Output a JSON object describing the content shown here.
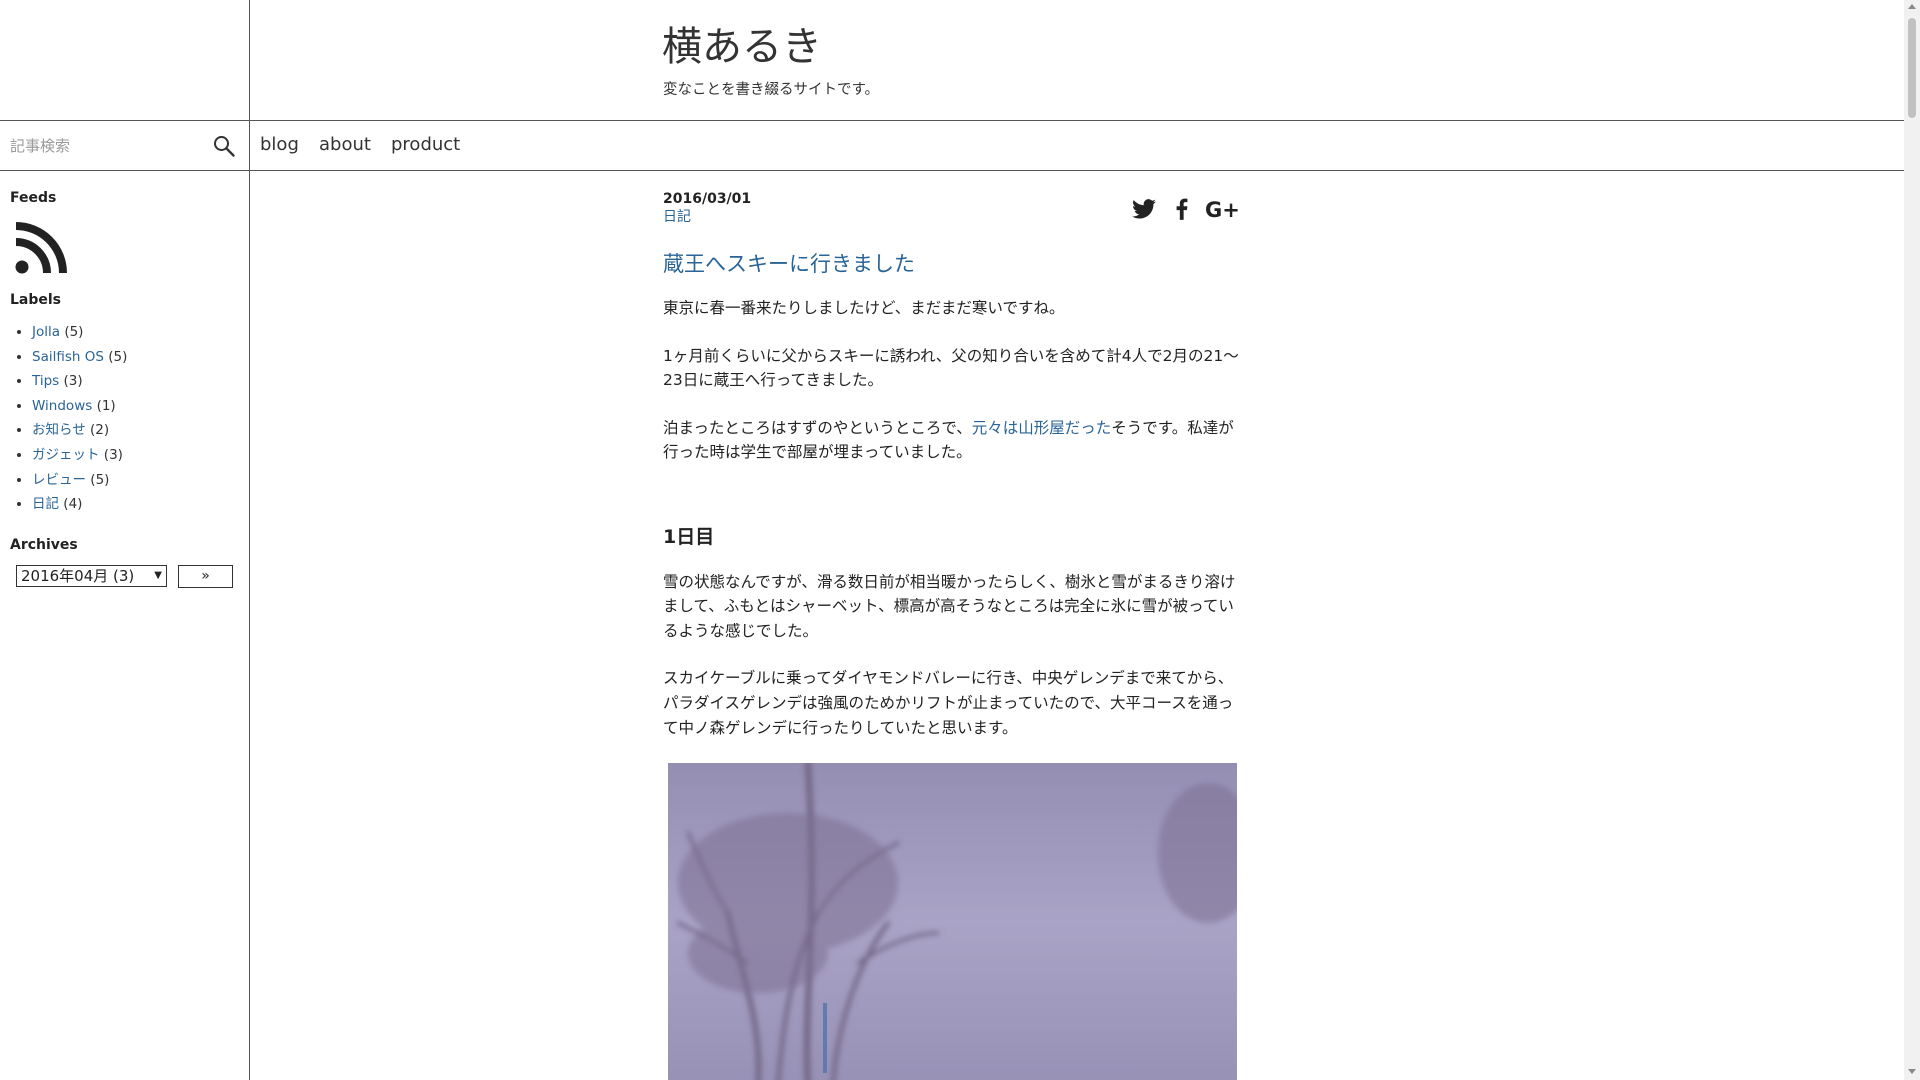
{
  "site": {
    "title": "横あるき",
    "description": "変なことを書き綴るサイトです。"
  },
  "search": {
    "placeholder": "記事検索",
    "icon": "search-icon"
  },
  "nav": [
    "blog",
    "about",
    "product"
  ],
  "sidebar": {
    "feeds_title": "Feeds",
    "labels_title": "Labels",
    "labels": [
      {
        "name": "Jolla",
        "count": "(5)"
      },
      {
        "name": "Sailfish OS",
        "count": "(5)"
      },
      {
        "name": "Tips",
        "count": "(3)"
      },
      {
        "name": "Windows",
        "count": "(1)"
      },
      {
        "name": "お知らせ",
        "count": "(2)"
      },
      {
        "name": "ガジェット",
        "count": "(3)"
      },
      {
        "name": "レビュー",
        "count": "(5)"
      },
      {
        "name": "日記",
        "count": "(4)"
      }
    ],
    "archives_title": "Archives",
    "archive_selected": "2016年04月 (3)",
    "archive_go": "»"
  },
  "post": {
    "date": "2016/03/01",
    "category": "日記",
    "title": "蔵王へスキーに行きました",
    "share": [
      "twitter-icon",
      "facebook-icon",
      "google-plus-icon"
    ],
    "p1": "東京に春一番来たりしましたけど、まだまだ寒いですね。",
    "p2": "1ヶ月前くらいに父からスキーに誘われ、父の知り合いを含めて計4人で2月の21〜23日に蔵王へ行ってきました。",
    "p3_before": "泊まったところはすずのやというところで、",
    "p3_link": "元々は山形屋だった",
    "p3_after": "そうです。私達が行った時は学生で部屋が埋まっていました。",
    "h_day1": "1日目",
    "p4": "雪の状態なんですが、滑る数日前が相当暖かったらしく、樹氷と雪がまるきり溶けまして、ふもとはシャーベット、標高が高そうなところは完全に氷に雪が被っているような感じでした。",
    "p5": "スカイケーブルに乗ってダイヤモンドバレーに行き、中央ゲレンデまで来てから、パラダイスゲレンデは強風のためかリフトが止まっていたので、大平コースを通って中ノ森ゲレンデに行ったりしていたと思います。"
  },
  "colors": {
    "link": "#2a6496",
    "text": "#222222",
    "border": "#555555"
  }
}
